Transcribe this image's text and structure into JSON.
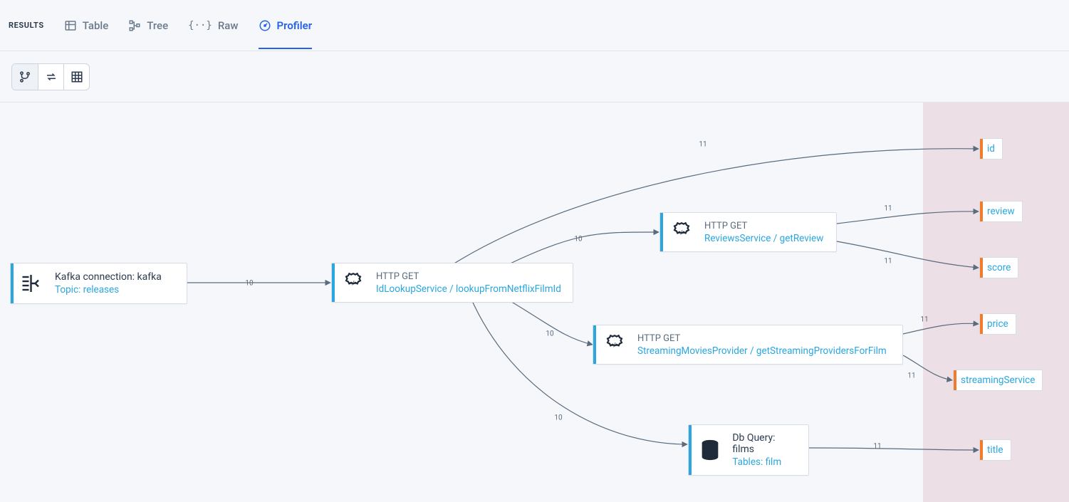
{
  "tabbar": {
    "results_label": "RESULTS",
    "tabs": {
      "table": "Table",
      "tree": "Tree",
      "raw": "Raw",
      "profiler": "Profiler"
    }
  },
  "nodes": {
    "kafka": {
      "line1": "Kafka connection: kafka",
      "line2": "Topic: releases"
    },
    "idlookup": {
      "line1": "HTTP GET",
      "line2": "IdLookupService / lookupFromNetflixFilmId"
    },
    "reviews": {
      "line1": "HTTP GET",
      "line2": "ReviewsService / getReview"
    },
    "streaming": {
      "line1": "HTTP GET",
      "line2": "StreamingMoviesProvider / getStreamingProvidersForFilm"
    },
    "dbfilms": {
      "line1": "Db Query: films",
      "line2": "Tables: film"
    }
  },
  "outputs": {
    "id": "id",
    "review": "review",
    "score": "score",
    "price": "price",
    "streamingService": "streamingService",
    "title": "title"
  },
  "edges": {
    "e1": "10",
    "e_id": "11",
    "e_rev_node": "10",
    "e_review": "11",
    "e_score": "11",
    "e_stream_node": "10",
    "e_price": "11",
    "e_streamsvc": "11",
    "e_db_node": "10",
    "e_title": "11"
  },
  "chart_data": {
    "type": "diagram",
    "title": "Profiler flow graph",
    "nodes": [
      {
        "id": "kafka",
        "kind": "source",
        "label": "Kafka connection: kafka",
        "sublabel": "Topic: releases"
      },
      {
        "id": "idlookup",
        "kind": "http_get",
        "label": "IdLookupService / lookupFromNetflixFilmId"
      },
      {
        "id": "reviews",
        "kind": "http_get",
        "label": "ReviewsService / getReview"
      },
      {
        "id": "streaming",
        "kind": "http_get",
        "label": "StreamingMoviesProvider / getStreamingProvidersForFilm"
      },
      {
        "id": "dbfilms",
        "kind": "db_query",
        "label": "Db Query: films",
        "sublabel": "Tables: film"
      },
      {
        "id": "out_id",
        "kind": "output",
        "label": "id"
      },
      {
        "id": "out_review",
        "kind": "output",
        "label": "review"
      },
      {
        "id": "out_score",
        "kind": "output",
        "label": "score"
      },
      {
        "id": "out_price",
        "kind": "output",
        "label": "price"
      },
      {
        "id": "out_streamingService",
        "kind": "output",
        "label": "streamingService"
      },
      {
        "id": "out_title",
        "kind": "output",
        "label": "title"
      }
    ],
    "edges": [
      {
        "from": "kafka",
        "to": "idlookup",
        "count": 10
      },
      {
        "from": "idlookup",
        "to": "out_id",
        "count": 11
      },
      {
        "from": "idlookup",
        "to": "reviews",
        "count": 10
      },
      {
        "from": "reviews",
        "to": "out_review",
        "count": 11
      },
      {
        "from": "reviews",
        "to": "out_score",
        "count": 11
      },
      {
        "from": "idlookup",
        "to": "streaming",
        "count": 10
      },
      {
        "from": "streaming",
        "to": "out_price",
        "count": 11
      },
      {
        "from": "streaming",
        "to": "out_streamingService",
        "count": 11
      },
      {
        "from": "idlookup",
        "to": "dbfilms",
        "count": 10
      },
      {
        "from": "dbfilms",
        "to": "out_title",
        "count": 11
      }
    ]
  }
}
